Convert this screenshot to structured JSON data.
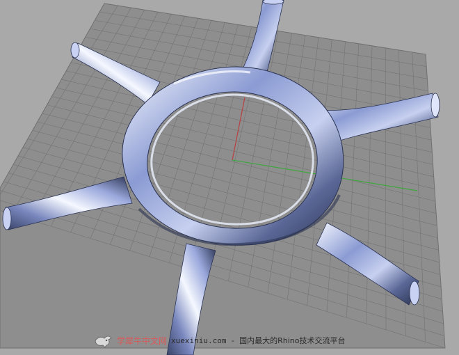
{
  "viewport": {
    "background_color": "#a9a9a9",
    "grid_color": "#8e8e8e",
    "grid_line_color": "#6f6f6f",
    "axis_x_color": "#3fa63f",
    "axis_y_color": "#b84040",
    "object": {
      "type": "six-armed ring tube",
      "material": "chrome",
      "highlight_color": "#f5f8ff",
      "mid_color": "#8b9bd3",
      "shadow_color": "#2b3352"
    }
  },
  "watermark": {
    "logo_icon": "cow-logo-icon",
    "site_name": "学犀牛中文网",
    "site_url": "xuexiniu.com",
    "separator": "-",
    "slogan": "国内最大的Rhino技术交流平台"
  }
}
